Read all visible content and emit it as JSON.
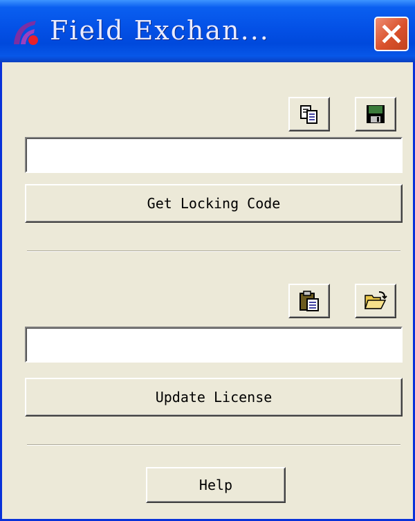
{
  "window": {
    "title": "Field Exchan...",
    "close_icon": "close-x-icon",
    "logo_icon": "app-logo-icon"
  },
  "locking_section": {
    "copy_icon": "copy-icon",
    "save_icon": "floppy-disk-save-icon",
    "locking_code_value": "",
    "get_locking_code_label": "Get Locking Code"
  },
  "license_section": {
    "paste_icon": "paste-clipboard-icon",
    "open_icon": "open-folder-icon",
    "license_value": "",
    "update_license_label": "Update License"
  },
  "footer": {
    "help_label": "Help"
  },
  "colors": {
    "titlebar": "#0451e6",
    "close_button": "#d9512c",
    "window_bg": "#ece9d8"
  }
}
